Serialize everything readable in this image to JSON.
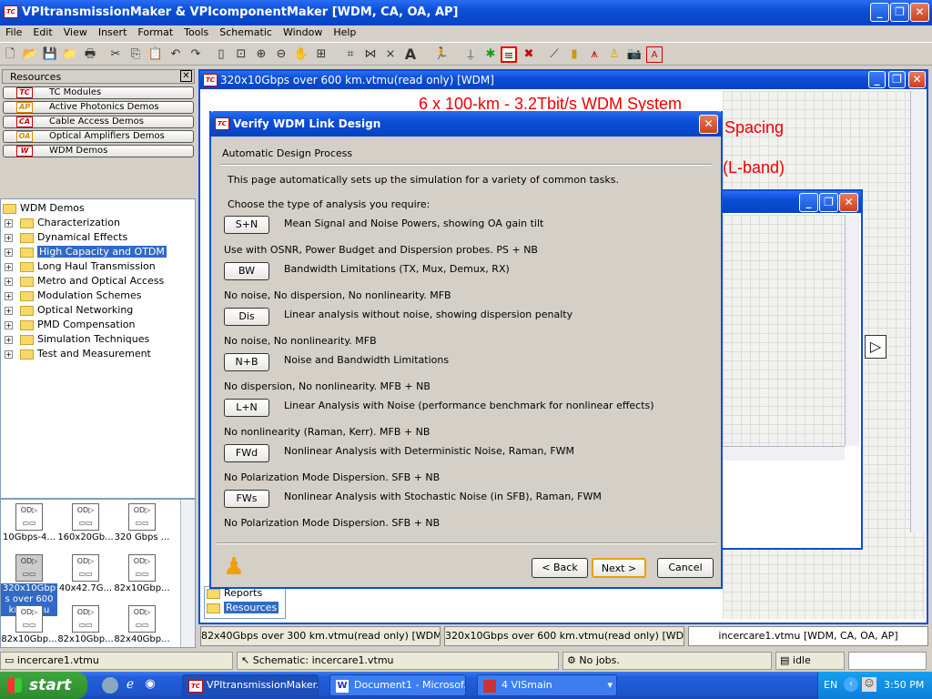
{
  "app": {
    "title": "VPItransmissionMaker & VPIcomponentMaker [WDM, CA, OA, AP]",
    "icon": "TC"
  },
  "menu": [
    "File",
    "Edit",
    "View",
    "Insert",
    "Format",
    "Tools",
    "Schematic",
    "Window",
    "Help"
  ],
  "resources": {
    "title": "Resources",
    "buttons": [
      {
        "badge": "TC",
        "label": "TC Modules"
      },
      {
        "badge": "AP",
        "label": "Active Photonics Demos"
      },
      {
        "badge": "CA",
        "label": "Cable Access Demos"
      },
      {
        "badge": "OA",
        "label": "Optical Amplifiers Demos"
      },
      {
        "badge": "W",
        "label": "WDM Demos"
      }
    ],
    "tree_root": "WDM Demos",
    "tree": [
      "Characterization",
      "Dynamical Effects",
      "High Capacity and OTDM",
      "Long Haul Transmission",
      "Metro and Optical Access",
      "Modulation Schemes",
      "Optical Networking",
      "PMD Compensation",
      "Simulation Techniques",
      "Test and Measurement"
    ],
    "selected_tree": "High Capacity and OTDM",
    "thumbs": [
      "10Gbps-4...",
      "160x20Gb...",
      "320 Gbps ...",
      "320x10Gbp s over 600 km.vtmu",
      "40x42.7G...",
      "82x10Gbp...",
      "82x10Gbp...",
      "82x10Gbp...",
      "82x40Gbp..."
    ]
  },
  "child_window": {
    "title": "320x10Gbps over 600 km.vtmu(read only) [WDM]",
    "red_lines": [
      "6 x 100-km - 3.2Tbit/s WDM System",
      "Spacing",
      "(L-band)"
    ],
    "tree_items": [
      "Reports",
      "Resources"
    ]
  },
  "dialog": {
    "title": "Verify WDM Link Design",
    "section": "Automatic Design Process",
    "intro": "This page automatically sets up the simulation for a variety of common tasks.",
    "prompt": "Choose the type of analysis you require:",
    "options": [
      {
        "btn": "S+N",
        "desc": "Mean Signal and Noise Powers, showing OA gain tilt",
        "note": "Use with OSNR, Power Budget and Dispersion probes. PS + NB"
      },
      {
        "btn": "BW",
        "desc": "Bandwidth Limitations (TX, Mux, Demux, RX)",
        "note": "No noise, No dispersion, No nonlinearity. MFB"
      },
      {
        "btn": "Dis",
        "desc": "Linear analysis without noise, showing dispersion penalty",
        "note": "No noise, No nonlinearity. MFB"
      },
      {
        "btn": "N+B",
        "desc": "Noise and Bandwidth Limitations",
        "note": "No dispersion, No nonlinearity. MFB + NB"
      },
      {
        "btn": "L+N",
        "desc": "Linear Analysis with Noise (performance benchmark for nonlinear effects)",
        "note": "No nonlinearity (Raman, Kerr). MFB + NB"
      },
      {
        "btn": "FWd",
        "desc": "Nonlinear Analysis with Deterministic Noise, Raman, FWM",
        "note": "No Polarization Mode Dispersion. SFB + NB"
      },
      {
        "btn": "FWs",
        "desc": "Nonlinear Analysis with Stochastic Noise (in  SFB), Raman, FWM",
        "note": "No Polarization Mode Dispersion. SFB + NB"
      }
    ],
    "back": "< Back",
    "next": "Next >",
    "cancel": "Cancel"
  },
  "doc_tabs": [
    "82x40Gbps over 300 km.vtmu(read only) [WDM]",
    "320x10Gbps over 600 km.vtmu(read only) [WD...",
    "incercare1.vtmu [WDM, CA, OA, AP]"
  ],
  "status": {
    "file": "incercare1.vtmu",
    "schematic": "Schematic: incercare1.vtmu",
    "jobs": "No jobs.",
    "state": "idle"
  },
  "taskbar": {
    "start": "start",
    "tasks": [
      "VPItransmissionMaker...",
      "Document1 - Microsof...",
      "4  VISmain"
    ],
    "lang": "EN",
    "time": "3:50 PM"
  },
  "colors": {
    "title_blue": "#0a4fd6",
    "accent_red": "#e00000",
    "selection": "#316ac5"
  }
}
